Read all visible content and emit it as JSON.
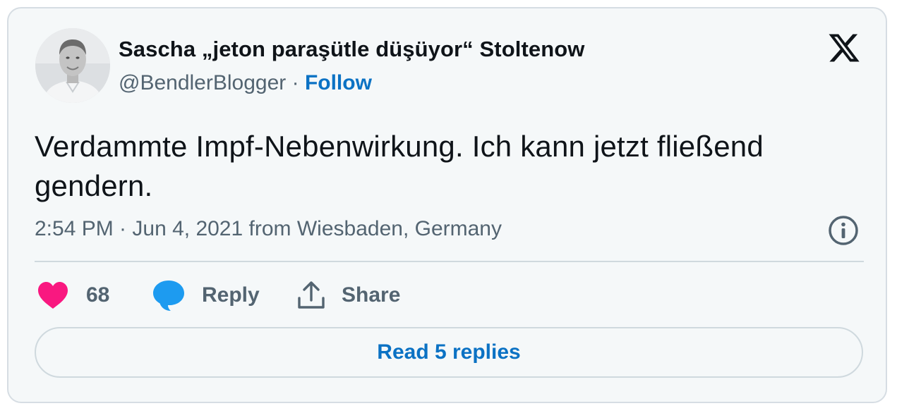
{
  "author": {
    "display_name": "Sascha „jeton paraşütle düşüyor“ Stoltenow",
    "handle": "@BendlerBlogger",
    "separator": " · ",
    "follow_label": "Follow",
    "avatar_icon": "person-photo-avatar"
  },
  "tweet": {
    "text": "Verdammte Impf-Nebenwirkung. Ich kann jetzt fließend gendern.",
    "timestamp": "2:54 PM · Jun 4, 2021 from Wiesbaden, Germany"
  },
  "actions": {
    "likes_count": "68",
    "reply_label": "Reply",
    "share_label": "Share",
    "read_replies_label": "Read 5 replies"
  },
  "icons": {
    "logo": "x-logo-icon",
    "info": "info-icon",
    "like": "heart-icon",
    "reply": "speech-bubble-icon",
    "share": "upload-share-icon"
  },
  "colors": {
    "background": "#f5f8f9",
    "border": "#d6dde3",
    "text_primary": "#0f1419",
    "text_secondary": "#536471",
    "link": "#0b72c4",
    "heart": "#f91880",
    "reply_bubble": "#1d9bf0"
  }
}
